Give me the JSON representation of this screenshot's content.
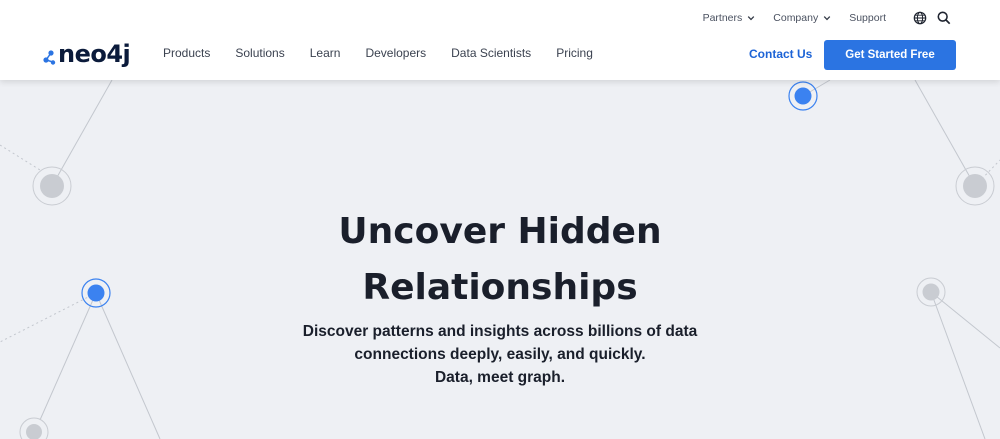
{
  "utility_nav": {
    "partners": "Partners",
    "company": "Company",
    "support": "Support",
    "globe_icon": "globe-icon",
    "search_icon": "search-icon"
  },
  "brand": {
    "logo_text": "neo4j"
  },
  "main_nav": {
    "items": [
      "Products",
      "Solutions",
      "Learn",
      "Developers",
      "Data Scientists",
      "Pricing"
    ]
  },
  "actions": {
    "contact": "Contact Us",
    "cta": "Get Started Free"
  },
  "hero": {
    "title_line1": "Uncover Hidden",
    "title_line2": "Relationships",
    "sub_line1": "Discover patterns and insights across billions of data",
    "sub_line2": "connections deeply, easily, and quickly.",
    "sub_line3": "Data, meet graph."
  },
  "colors": {
    "accent_blue": "#2b74e2",
    "link_blue": "#1c63d6",
    "node_blue": "#3b82f0",
    "node_gray": "#c9ccd2",
    "background": "#eef0f4"
  }
}
